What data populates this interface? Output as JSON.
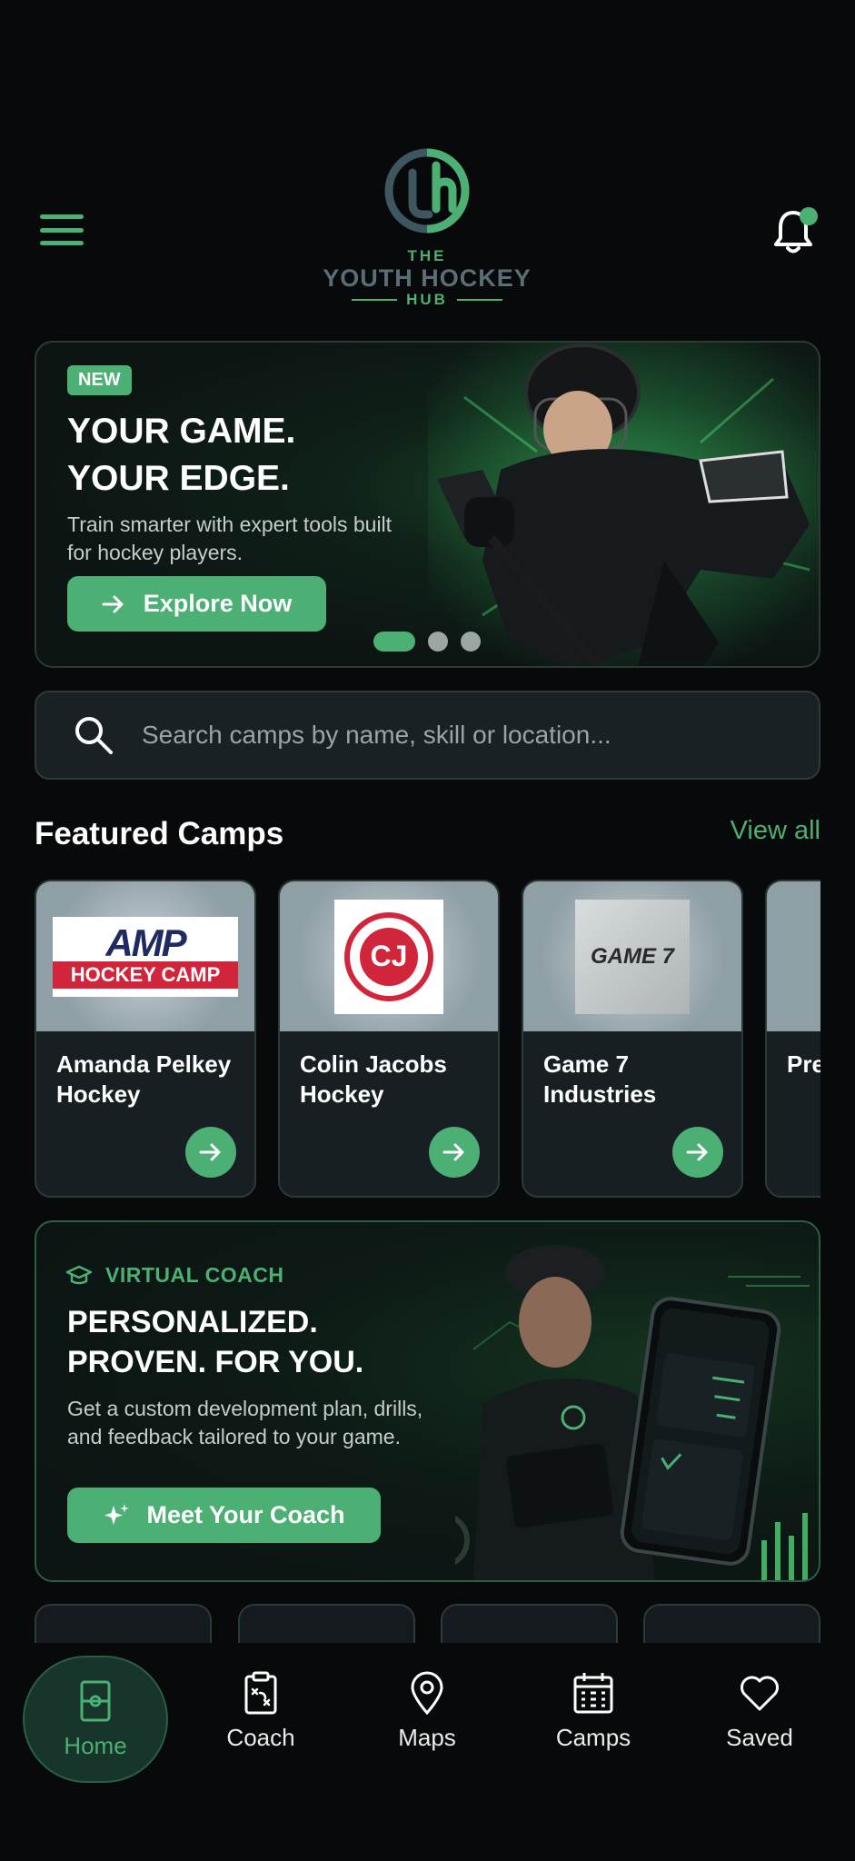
{
  "header": {
    "logo_the": "THE",
    "logo_name": "YOUTH HOCKEY",
    "logo_hub": "HUB"
  },
  "hero": {
    "badge": "NEW",
    "title_line1": "YOUR GAME.",
    "title_line2": "YOUR EDGE.",
    "subtitle": "Train smarter with expert tools built for hockey players.",
    "cta": "Explore Now",
    "slides": 3,
    "active_slide": 1
  },
  "search": {
    "placeholder": "Search camps by name, skill or location..."
  },
  "featured": {
    "title": "Featured Camps",
    "view_all": "View all",
    "camps": [
      {
        "name": "Amanda Pelkey Hockey",
        "logo_text_top": "AMP",
        "logo_text_bottom": "HOCKEY CAMP"
      },
      {
        "name": "Colin Jacobs Hockey",
        "logo_text": "CJ"
      },
      {
        "name": "Game 7 Industries",
        "logo_text": "GAME 7"
      },
      {
        "name": "Pre Ho"
      }
    ]
  },
  "coach": {
    "label": "VIRTUAL COACH",
    "title_line1": "PERSONALIZED.",
    "title_line2": "PROVEN. FOR YOU.",
    "subtitle": "Get a custom development plan, drills, and feedback tailored to your game.",
    "cta": "Meet Your Coach"
  },
  "nav": {
    "items": [
      {
        "label": "Home",
        "icon": "rink-icon",
        "active": true
      },
      {
        "label": "Coach",
        "icon": "clipboard-icon",
        "active": false
      },
      {
        "label": "Maps",
        "icon": "map-pin-icon",
        "active": false
      },
      {
        "label": "Camps",
        "icon": "calendar-icon",
        "active": false
      },
      {
        "label": "Saved",
        "icon": "heart-icon",
        "active": false
      }
    ]
  },
  "colors": {
    "accent": "#4caf74",
    "background": "#07090a",
    "card": "#181f23"
  }
}
